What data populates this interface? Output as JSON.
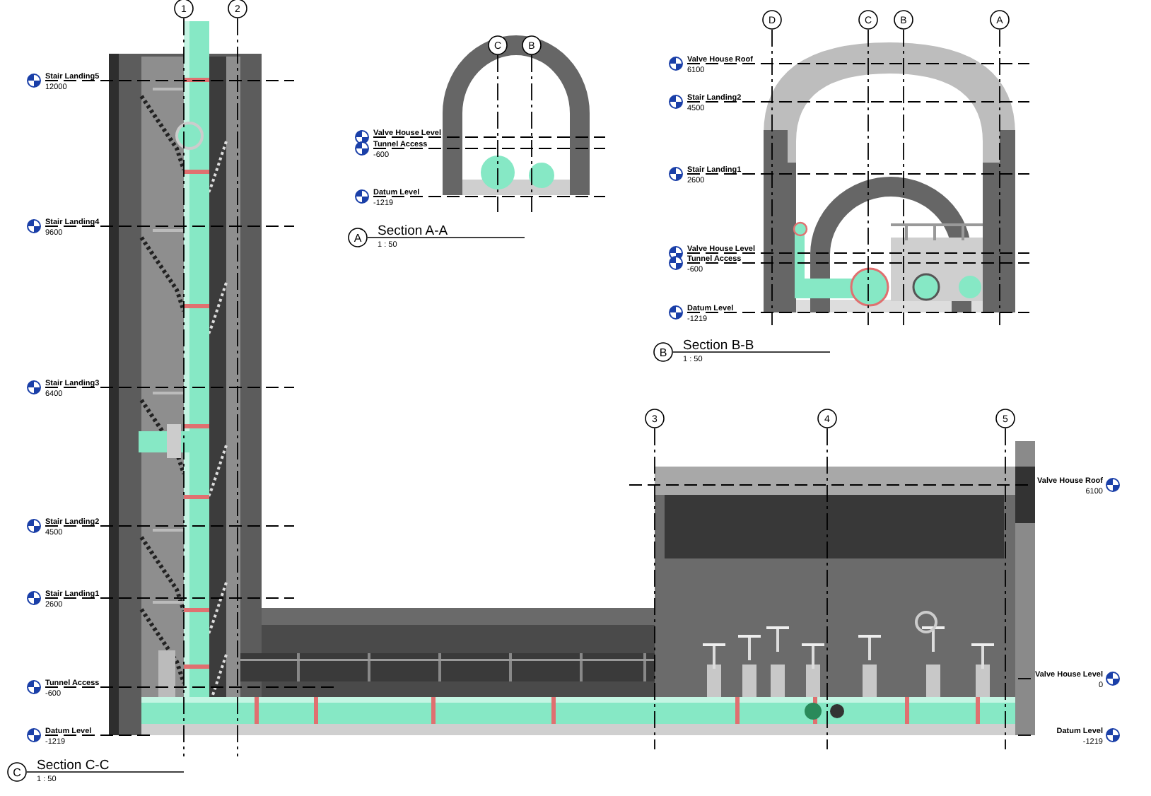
{
  "sections": [
    {
      "kind": "tower_tunnel",
      "mark": "C",
      "title": "Section C-C",
      "scale": "1 : 50",
      "grids": [
        "1",
        "2",
        "3",
        "4",
        "5"
      ],
      "left_levels": [
        {
          "name": "Stair Landing5",
          "elevation": "12000"
        },
        {
          "name": "Stair Landing4",
          "elevation": "9600"
        },
        {
          "name": "Stair Landing3",
          "elevation": "6400"
        },
        {
          "name": "Stair Landing2",
          "elevation": "4500"
        },
        {
          "name": "Stair Landing1",
          "elevation": "2600"
        },
        {
          "name": "Tunnel Access",
          "elevation": "-600"
        },
        {
          "name": "Datum Level",
          "elevation": "-1219"
        }
      ],
      "right_levels": [
        {
          "name": "Valve House Roof",
          "elevation": "6100"
        },
        {
          "name": "Valve House Level",
          "elevation": "0"
        },
        {
          "name": "Datum Level",
          "elevation": "-1219"
        }
      ]
    },
    {
      "kind": "arch",
      "mark": "A",
      "title": "Section A-A",
      "scale": "1 : 50",
      "grids": [
        "C",
        "B"
      ],
      "left_levels": [
        {
          "name": "Valve House Level"
        },
        {
          "name": "Tunnel Access",
          "elevation": "-600"
        },
        {
          "name": "Datum Level",
          "elevation": "-1219"
        }
      ]
    },
    {
      "kind": "valve_house",
      "mark": "B",
      "title": "Section B-B",
      "scale": "1 : 50",
      "grids": [
        "D",
        "C",
        "B",
        "A"
      ],
      "left_levels": [
        {
          "name": "Valve House Roof",
          "elevation": "6100"
        },
        {
          "name": "Stair Landing2",
          "elevation": "4500"
        },
        {
          "name": "Stair Landing1",
          "elevation": "2600"
        },
        {
          "name": "Valve House Level"
        },
        {
          "name": "Tunnel Access",
          "elevation": "-600"
        },
        {
          "name": "Datum Level",
          "elevation": "-1219"
        }
      ]
    }
  ]
}
